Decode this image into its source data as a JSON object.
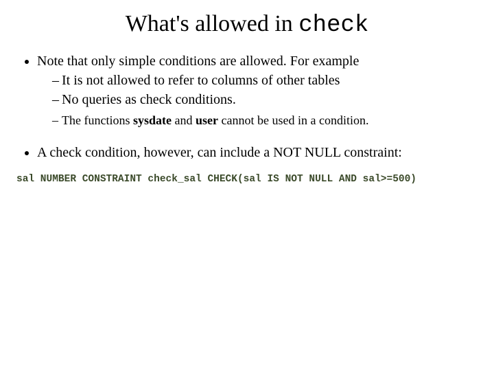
{
  "title": {
    "prefix": "What's allowed in ",
    "code": "check"
  },
  "bullets": {
    "b1": "Note that only simple conditions are allowed. For example",
    "b1_sub1": "It is not allowed to refer to columns of other tables",
    "b1_sub2": "No queries as check conditions.",
    "b1_sub3_pre": "The functions ",
    "b1_sub3_k1": "sysdate",
    "b1_sub3_mid": " and ",
    "b1_sub3_k2": "user",
    "b1_sub3_post": " cannot be used in a condition.",
    "b2": "A check condition, however, can include a NOT NULL constraint:"
  },
  "code": "sal NUMBER CONSTRAINT check_sal CHECK(sal IS NOT NULL AND sal>=500)"
}
